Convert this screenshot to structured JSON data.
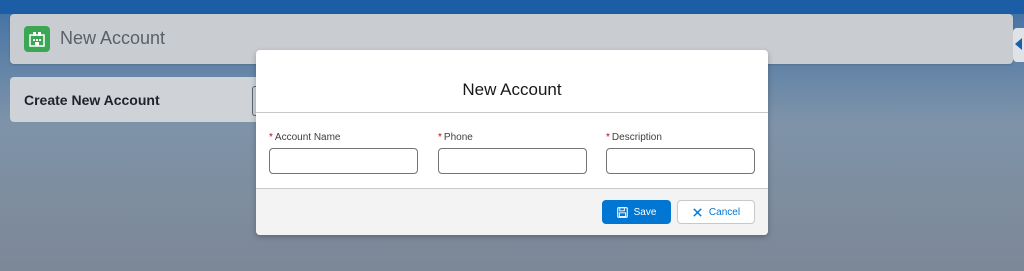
{
  "header": {
    "title": "New Account",
    "icon": "account-icon"
  },
  "card": {
    "title": "Create New Account"
  },
  "modal": {
    "title": "New Account",
    "fields": [
      {
        "label": "Account Name",
        "required_mark": "*",
        "value": ""
      },
      {
        "label": "Phone",
        "required_mark": "*",
        "value": ""
      },
      {
        "label": "Description",
        "required_mark": "*",
        "value": ""
      }
    ],
    "save_label": "Save",
    "cancel_label": "Cancel"
  },
  "colors": {
    "brand_blue": "#0176d3",
    "required_red": "#ba0517",
    "app_icon_green": "#3ba755"
  }
}
